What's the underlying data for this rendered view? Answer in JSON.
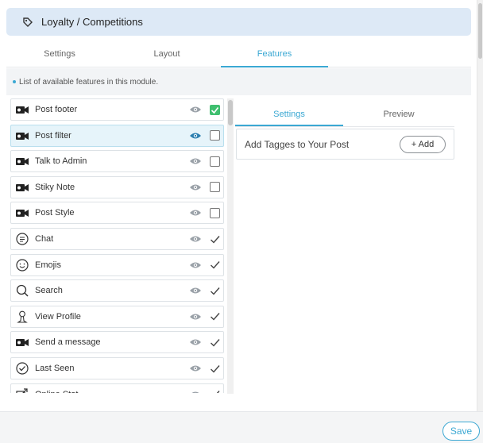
{
  "header": {
    "title": "Loyalty / Competitions",
    "icon": "tag-icon"
  },
  "tabs": [
    {
      "label": "Settings",
      "active": false
    },
    {
      "label": "Layout",
      "active": false
    },
    {
      "label": "Features",
      "active": true
    }
  ],
  "info": {
    "text": "List of available features in this module."
  },
  "features": [
    {
      "label": "Post footer",
      "icon": "video-camera-icon",
      "control": "checkbox",
      "checked": true,
      "selected": false
    },
    {
      "label": "Post filter",
      "icon": "video-camera-icon",
      "control": "checkbox",
      "checked": false,
      "selected": true
    },
    {
      "label": "Talk to Admin",
      "icon": "video-camera-icon",
      "control": "checkbox",
      "checked": false,
      "selected": false
    },
    {
      "label": "Stiky Note",
      "icon": "video-camera-icon",
      "control": "checkbox",
      "checked": false,
      "selected": false
    },
    {
      "label": "Post Style",
      "icon": "video-camera-icon",
      "control": "checkbox",
      "checked": false,
      "selected": false
    },
    {
      "label": "Chat",
      "icon": "chat-bubble-icon",
      "control": "check",
      "checked": true,
      "selected": false
    },
    {
      "label": "Emojis",
      "icon": "smiley-icon",
      "control": "check",
      "checked": true,
      "selected": false
    },
    {
      "label": "Search",
      "icon": "search-icon",
      "control": "check",
      "checked": true,
      "selected": false
    },
    {
      "label": "View Profile",
      "icon": "profile-icon",
      "control": "check",
      "checked": true,
      "selected": false
    },
    {
      "label": "Send a message",
      "icon": "video-camera-icon",
      "control": "check",
      "checked": true,
      "selected": false
    },
    {
      "label": "Last Seen",
      "icon": "check-circle-icon",
      "control": "check",
      "checked": true,
      "selected": false
    },
    {
      "label": "Online Stat",
      "icon": "share-icon",
      "control": "check",
      "checked": true,
      "selected": false
    }
  ],
  "subtabs": [
    {
      "label": "Settings",
      "active": true
    },
    {
      "label": "Preview",
      "active": false
    }
  ],
  "tags": {
    "label": "Add Tagges to Your Post",
    "add_label": "+ Add"
  },
  "footer": {
    "save_label": "Save"
  },
  "colors": {
    "accent": "#3ba8d3",
    "header_bg": "#dde9f6",
    "checked_green": "#3fbf6f"
  }
}
